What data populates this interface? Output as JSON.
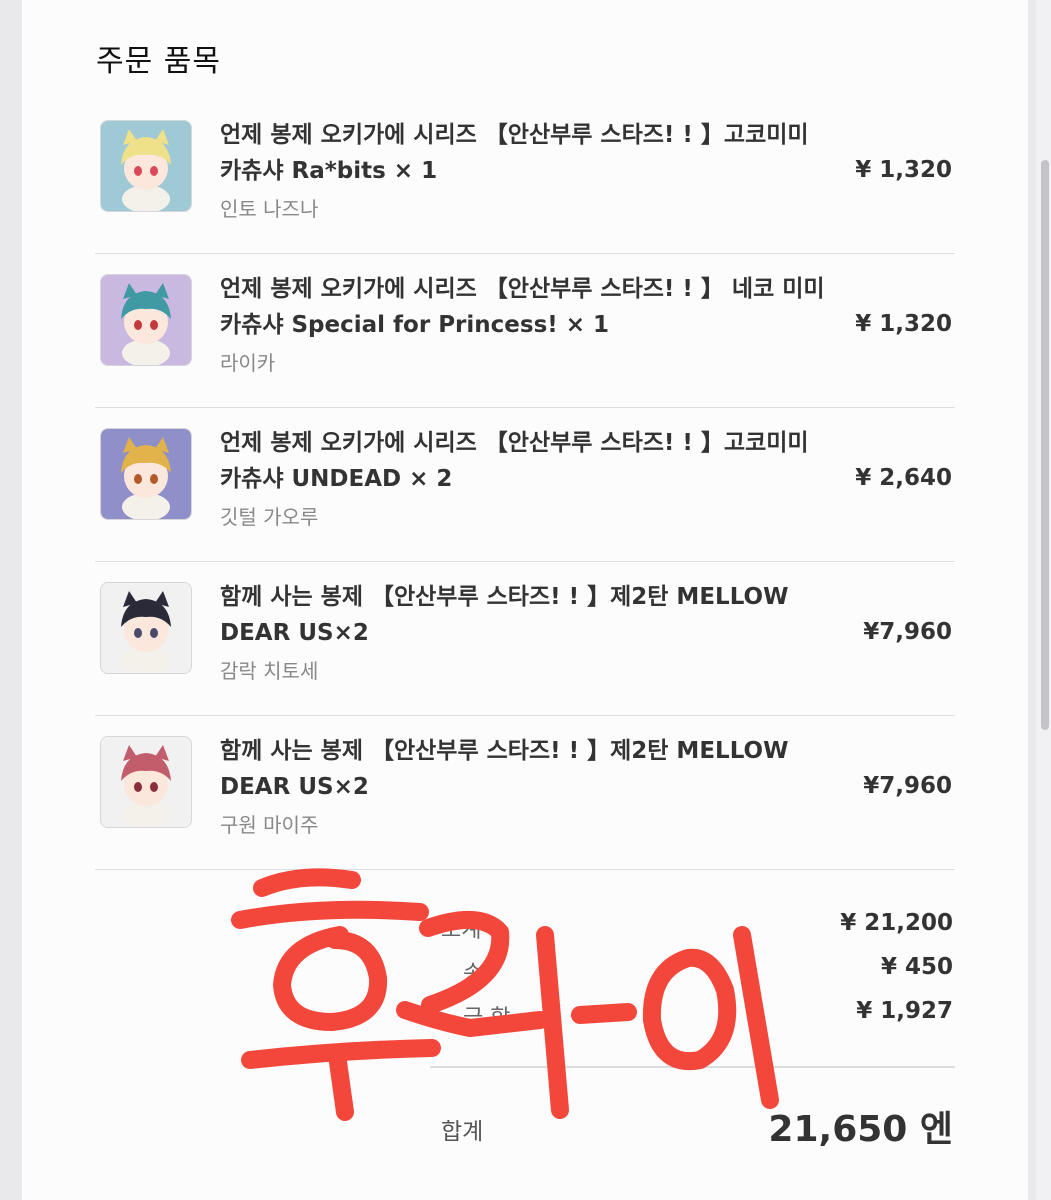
{
  "section_title": "주문 품목",
  "items": [
    {
      "name": "언제 봉제 오키가에 시리즈 【안산부루 스타즈! ! 】고코미미 카츄샤 Ra*bits × 1",
      "option": "인토 나즈나",
      "price": "¥ 1,320",
      "thumb": {
        "bg": "#9fc9d4",
        "hair": "#efe08a",
        "eye": "#d9475a"
      }
    },
    {
      "name": "언제 봉제 오키가에 시리즈 【안산부루 스타즈! ! 】 네코 미미 카츄샤 Special for Princess! × 1",
      "option": "라이카",
      "price": "¥ 1,320",
      "thumb": {
        "bg": "#c9b8df",
        "hair": "#3f9aa3",
        "eye": "#c23a3a"
      }
    },
    {
      "name": "언제 봉제 오키가에 시리즈 【안산부루 스타즈! ! 】고코미미 카츄샤 UNDEAD × 2",
      "option": "깃털 가오루",
      "price": "¥ 2,640",
      "thumb": {
        "bg": "#8f8fc9",
        "hair": "#e2b34a",
        "eye": "#b35a2c"
      }
    },
    {
      "name": "함께 사는 봉제 【안산부루 스타즈! ! 】제2탄 MELLOW DEAR US×2",
      "option": "감락 치토세",
      "price": "¥7,960",
      "thumb": {
        "bg": "#f1f1f1",
        "hair": "#2a2a38",
        "eye": "#4a4a6a"
      }
    },
    {
      "name": "함께 사는 봉제 【안산부루 스타즈! ! 】제2탄 MELLOW DEAR US×2",
      "option": "구원 마이주",
      "price": "¥7,960",
      "thumb": {
        "bg": "#f1f1f1",
        "hair": "#c25d6c",
        "eye": "#8a2d3c"
      }
    }
  ],
  "summary": {
    "subtotal_label": "소계",
    "subtotal_value": "¥ 21,200",
    "shipping_label": "송",
    "shipping_value": "¥ 450",
    "tax_label": "금 합",
    "tax_value": "¥ 1,927",
    "total_label": "합계",
    "total_value": "21,650 엔"
  },
  "colors": {
    "scribble": "#f2473a",
    "card": "#fcfcfd",
    "text": "#333333"
  }
}
